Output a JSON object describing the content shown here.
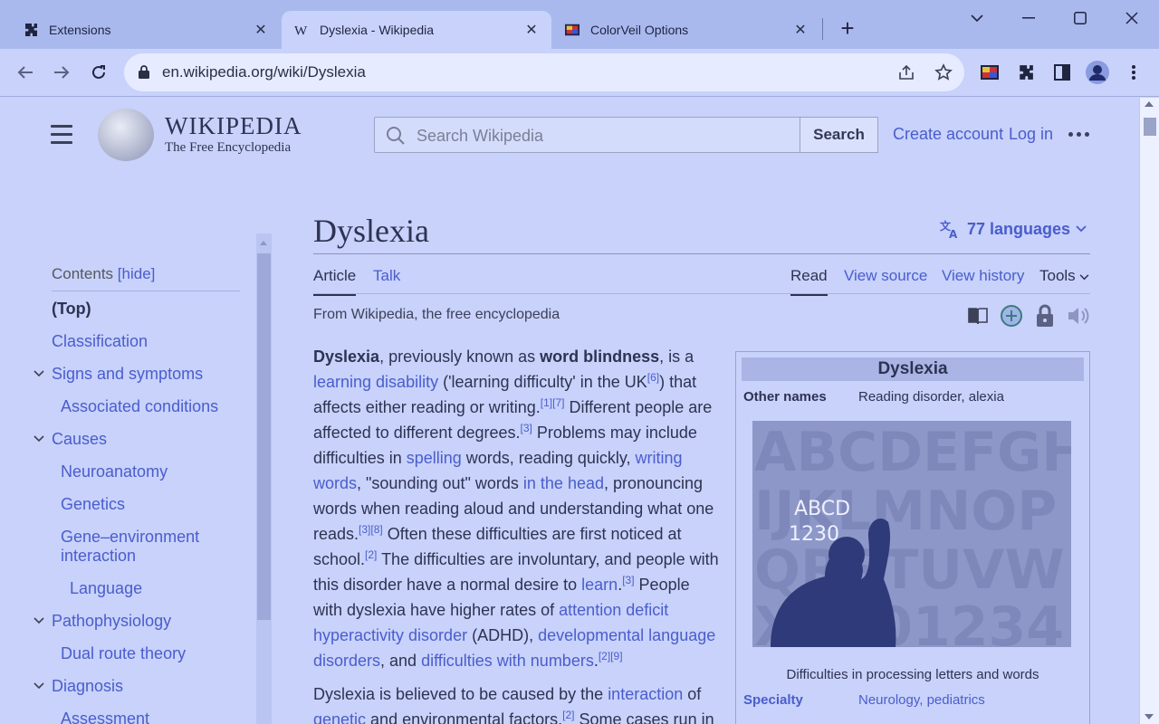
{
  "browser": {
    "tabs": [
      {
        "label": "Extensions",
        "icon": "puzzle-icon",
        "active": false
      },
      {
        "label": "Dyslexia - Wikipedia",
        "icon": "wikipedia-w-icon",
        "active": true
      },
      {
        "label": "ColorVeil Options",
        "icon": "colorveil-icon",
        "active": false
      }
    ],
    "url": "en.wikipedia.org/wiki/Dyslexia"
  },
  "header": {
    "wordmark": "WIKIPEDIA",
    "tagline": "The Free Encyclopedia",
    "search_placeholder": "Search Wikipedia",
    "search_button": "Search",
    "create_account": "Create account",
    "log_in": "Log in"
  },
  "toc": {
    "heading": "Contents",
    "hide": "[hide]",
    "items": [
      {
        "label": "(Top)"
      },
      {
        "label": "Classification"
      },
      {
        "label": "Signs and symptoms"
      },
      {
        "label": "Associated conditions"
      },
      {
        "label": "Causes"
      },
      {
        "label": "Neuroanatomy"
      },
      {
        "label": "Genetics"
      },
      {
        "label": "Gene–environment"
      },
      {
        "label": "interaction"
      },
      {
        "label": "Language"
      },
      {
        "label": "Pathophysiology"
      },
      {
        "label": "Dual route theory"
      },
      {
        "label": "Diagnosis"
      },
      {
        "label": "Assessment"
      }
    ]
  },
  "article": {
    "title": "Dyslexia",
    "languages": "77 languages",
    "tabs": {
      "article": "Article",
      "talk": "Talk",
      "read": "Read",
      "view_source": "View source",
      "view_history": "View history",
      "tools": "Tools"
    },
    "from": "From Wikipedia, the free encyclopedia"
  },
  "infobox": {
    "title": "Dyslexia",
    "other_names_label": "Other names",
    "other_names": "Reading disorder, alexia",
    "caption": "Difficulties in processing letters and words",
    "specialty_label": "Specialty",
    "specialty": "Neurology, pediatrics",
    "image_rows": [
      "ABCDEFGH",
      "IJKLMNOP",
      "QRSTUVW",
      "XYZ01234"
    ],
    "chalk_letters": [
      "ABCD",
      "1230"
    ]
  },
  "colors": {
    "link": "#4a5dcc",
    "text": "#2d3352",
    "page_bg": "#c8d2fb"
  }
}
